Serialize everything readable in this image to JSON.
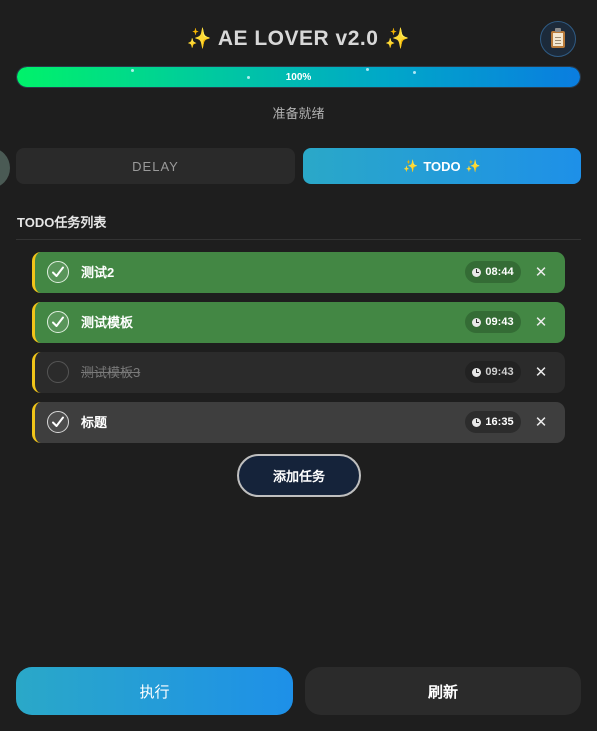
{
  "header": {
    "sparkle_left": "✨",
    "title": "AE LOVER v2.0",
    "sparkle_right": "✨",
    "clipboard_icon": "clipboard-icon"
  },
  "progress": {
    "value": 1.0,
    "label": "100%"
  },
  "status_text": "准备就绪",
  "tabs": [
    {
      "label": "DELAY",
      "active": false
    },
    {
      "label": "TODO",
      "active": true,
      "decor": "✨"
    }
  ],
  "todo": {
    "section_title": "TODO任务列表",
    "tasks": [
      {
        "name": "测试2",
        "time": "08:44",
        "checked": true,
        "state": "done"
      },
      {
        "name": "测试模板",
        "time": "09:43",
        "checked": true,
        "state": "done"
      },
      {
        "name": "测试模板3",
        "time": "09:43",
        "checked": false,
        "state": "pending"
      },
      {
        "name": "标题",
        "time": "16:35",
        "checked": true,
        "state": "active"
      }
    ],
    "delete_symbol": "✕",
    "add_label": "添加任务"
  },
  "footer": {
    "execute_label": "执行",
    "refresh_label": "刷新"
  },
  "colors": {
    "accent": "#1e90e8",
    "done": "#438744",
    "marker": "#f0c419",
    "progress_start": "#00f26a",
    "progress_end": "#0a7de0"
  }
}
